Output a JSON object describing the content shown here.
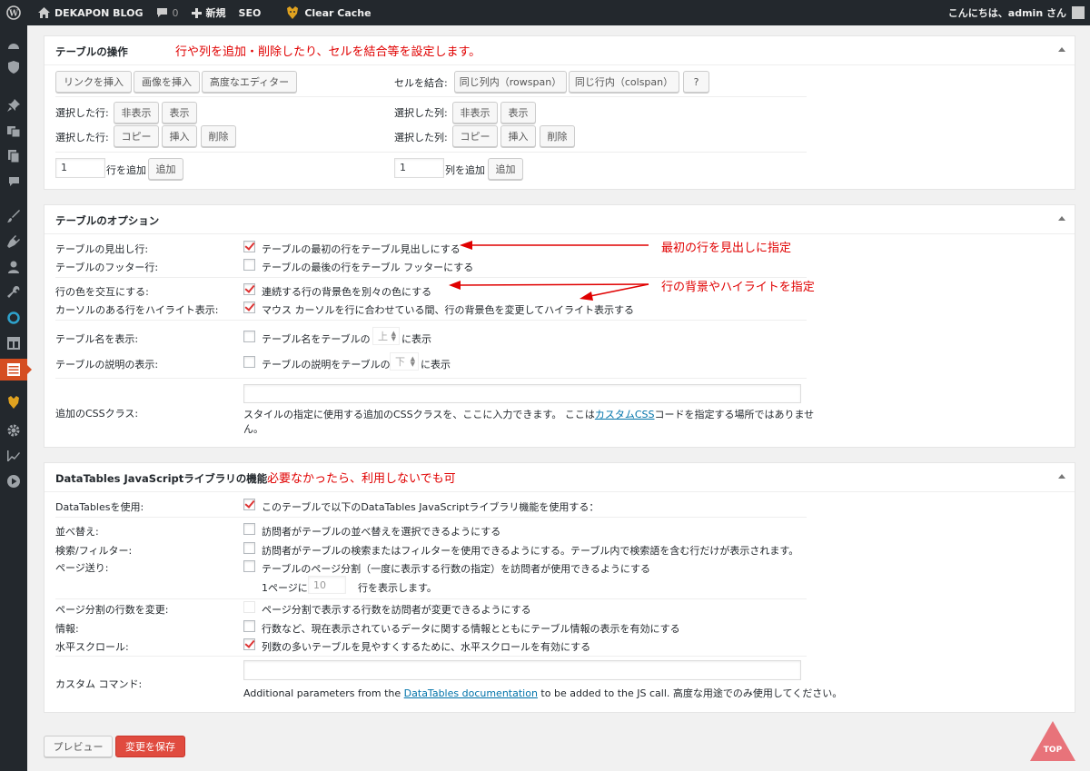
{
  "admin_bar": {
    "site_name": "DEKAPON BLOG",
    "comments_count": "0",
    "new_label": "新規",
    "seo_label": "SEO",
    "clear_cache_label": "Clear Cache",
    "greeting": "こんにちは、admin さん"
  },
  "table_ops": {
    "title": "テーブルの操作",
    "annotation": "行や列を追加・削除したり、セルを結合等を設定します。",
    "insert_link": "リンクを挿入",
    "insert_image": "画像を挿入",
    "advanced_editor": "高度なエディター",
    "merge_cells_label": "セルを結合:",
    "rowspan_btn": "同じ列内（rowspan）",
    "colspan_btn": "同じ行内（colspan）",
    "help_btn": "?",
    "selected_rows_label": "選択した行:",
    "selected_cols_label": "選択した列:",
    "hide_btn": "非表示",
    "show_btn": "表示",
    "copy_btn": "コピー",
    "insert_btn": "挿入",
    "delete_btn": "削除",
    "add_rows_value": "1",
    "add_rows_label": "行を追加",
    "add_cols_value": "1",
    "add_cols_label": "列を追加",
    "add_btn": "追加"
  },
  "table_options": {
    "title": "テーブルのオプション",
    "annotation_header": "最初の行を見出しに指定",
    "annotation_bg": "行の背景やハイライトを指定",
    "rows": [
      {
        "label": "テーブルの見出し行:",
        "text": "テーブルの最初の行をテーブル見出しにする",
        "checked": true
      },
      {
        "label": "テーブルのフッター行:",
        "text": "テーブルの最後の行をテーブル フッターにする",
        "checked": false
      },
      {
        "label": "行の色を交互にする:",
        "text": "連続する行の背景色を別々の色にする",
        "checked": true
      },
      {
        "label": "カーソルのある行をハイライト表示:",
        "text": "マウス カーソルを行に合わせている間、行の背景色を変更してハイライト表示する",
        "checked": true
      },
      {
        "label": "テーブル名を表示:",
        "text_before": "テーブル名をテーブルの",
        "select": "上",
        "text_after": "に表示",
        "checked": false
      },
      {
        "label": "テーブルの説明の表示:",
        "text_before": "テーブルの説明をテーブルの",
        "select": "下",
        "text_after": "に表示",
        "checked": false
      }
    ],
    "css_label": "追加のCSSクラス:",
    "css_value": "",
    "css_desc_before": "スタイルの指定に使用する追加のCSSクラスを、ここに入力できます。 ここは",
    "css_desc_link": "カスタムCSS",
    "css_desc_after": "コードを指定する場所ではありませ",
    "css_desc_cont": "ん。"
  },
  "datatables": {
    "title": "DataTables JavaScriptライブラリの機能",
    "annotation": "必要なかったら、利用しないでも可",
    "use_label": "DataTablesを使用:",
    "use_text": "このテーブルで以下のDataTables JavaScriptライブラリ機能を使用する：",
    "use_checked": true,
    "rows": [
      {
        "label": "並べ替え:",
        "text": "訪問者がテーブルの並べ替えを選択できるようにする",
        "checked": false
      },
      {
        "label": "検索/フィルター:",
        "text": "訪問者がテーブルの検索またはフィルターを使用できるようにする。テーブル内で検索語を含む行だけが表示されます。",
        "checked": false
      },
      {
        "label": "ページ送り:",
        "text": "テーブルのページ分割（一度に表示する行数の指定）を訪問者が使用できるようにする",
        "checked": false
      }
    ],
    "per_page_before": "1ページに",
    "per_page_value": "10",
    "per_page_after": "行を表示します。",
    "rows2": [
      {
        "label": "ページ分割の行数を変更:",
        "text": "ページ分割で表示する行数を訪問者が変更できるようにする",
        "checked": false
      },
      {
        "label": "情報:",
        "text": "行数など、現在表示されているデータに関する情報とともにテーブル情報の表示を有効にする",
        "checked": false
      },
      {
        "label": "水平スクロール:",
        "text": "列数の多いテーブルを見やすくするために、水平スクロールを有効にする",
        "checked": true
      }
    ],
    "custom_label": "カスタム コマンド:",
    "custom_value": "",
    "custom_desc_before": "Additional parameters from the ",
    "custom_desc_link": "DataTables documentation",
    "custom_desc_after": " to be added to the JS call. 高度な用途でのみ使用してください。"
  },
  "footer": {
    "preview_btn": "プレビュー",
    "save_btn": "変更を保存",
    "top_btn": "TOP"
  },
  "colors": {
    "admin_bar": "#23282d",
    "annotation": "#e00000",
    "primary_button": "#e04b3f",
    "active_menu": "#d54e21",
    "top_button": "#e8737a"
  }
}
